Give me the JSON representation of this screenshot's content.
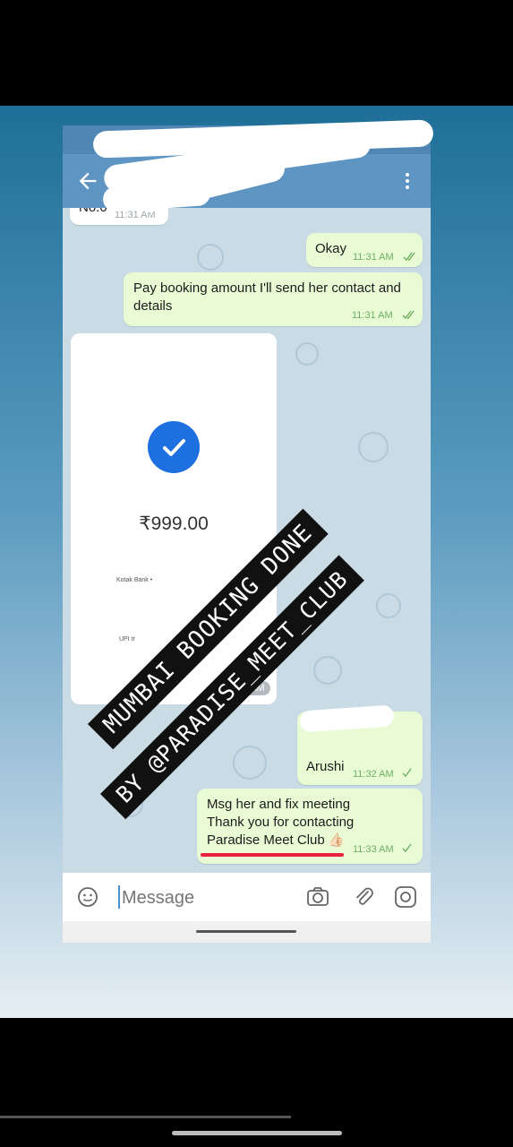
{
  "chat": {
    "partial_message": {
      "text": "No.0",
      "time": "11:31 AM"
    },
    "msg_okay": {
      "text": "Okay",
      "time": "11:31 AM"
    },
    "msg_pay": {
      "line1": "Pay booking amount I'll send her contact and",
      "line2": "details",
      "time": "11:31 AM"
    },
    "payment_image": {
      "amount": "₹999.00",
      "bank_line": "Kotak Bank • ",
      "upi_line": "UPI tr",
      "time": "11:32 AM"
    },
    "msg_arushi": {
      "text": "Arushi",
      "time": "11:32 AM"
    },
    "msg_last": {
      "line1": "Msg her and fix meeting",
      "line2": "Thank you for contacting",
      "line3": "Paradise Meet Club",
      "emoji": "👍🏻",
      "time": "11:33 AM"
    }
  },
  "input": {
    "placeholder": "Message"
  },
  "overlay": {
    "line1": "MUMBAI BOOKING DONE",
    "line2": "BY @PARADISE_MEET_CLUB"
  },
  "icons": [
    "back-arrow-icon",
    "more-vert-icon",
    "emoji-icon",
    "camera-icon",
    "attach-icon",
    "instagram-icon",
    "double-check-icon",
    "single-check-icon",
    "check-icon"
  ],
  "colors": {
    "app_bar": "#5e95c2",
    "bubble_out": "#e9fbd5",
    "check_circle": "#1e6fe0",
    "underline": "#e8223f"
  }
}
